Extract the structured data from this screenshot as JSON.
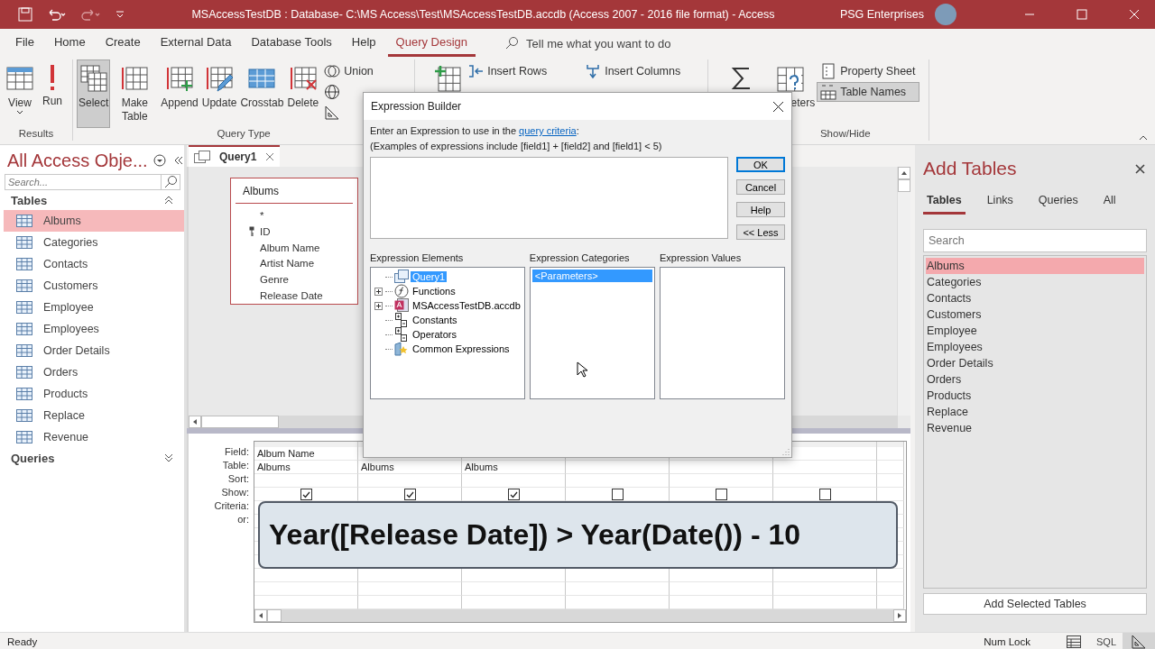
{
  "window": {
    "title": "MSAccessTestDB : Database- C:\\MS Access\\Test\\MSAccessTestDB.accdb (Access 2007 - 2016 file format)  -  Access",
    "user": "PSG Enterprises"
  },
  "menu_tabs": [
    {
      "label": "File",
      "selected": false
    },
    {
      "label": "Home",
      "selected": false
    },
    {
      "label": "Create",
      "selected": false
    },
    {
      "label": "External Data",
      "selected": false
    },
    {
      "label": "Database Tools",
      "selected": false
    },
    {
      "label": "Help",
      "selected": false
    },
    {
      "label": "Query Design",
      "selected": true
    }
  ],
  "tell_me": {
    "placeholder": "Tell me what you want to do"
  },
  "ribbon": {
    "groups": [
      {
        "label": "Results",
        "controls": [
          {
            "kind": "large",
            "label": "View",
            "dropdown": true,
            "selected": false
          },
          {
            "kind": "large",
            "label": "Run",
            "selected": false
          }
        ]
      },
      {
        "label": "Query Type",
        "controls": [
          {
            "kind": "large",
            "label": "Select",
            "selected": true
          },
          {
            "kind": "large",
            "label": "Make Table",
            "selected": false
          },
          {
            "kind": "large",
            "label": "Append",
            "selected": false
          },
          {
            "kind": "large",
            "label": "Update",
            "selected": false
          },
          {
            "kind": "large",
            "label": "Crosstab",
            "selected": false
          },
          {
            "kind": "large",
            "label": "Delete",
            "selected": false
          },
          {
            "kind": "column",
            "items": [
              {
                "label": "Union",
                "selected": false
              },
              {
                "selected": false
              },
              {
                "selected": false
              }
            ]
          }
        ]
      },
      {
        "controls": [
          {
            "kind": "large",
            "selected": false
          },
          {
            "kind": "column",
            "items": [
              {
                "label": "Insert Rows",
                "selected": false
              }
            ]
          },
          {
            "kind": "column",
            "items": [
              {
                "label": "Insert Columns",
                "selected": false
              }
            ]
          }
        ]
      },
      {
        "label": "Show/Hide",
        "controls": [
          {
            "kind": "large",
            "selected": false
          },
          {
            "kind": "large",
            "label": "eters",
            "selected": false
          },
          {
            "kind": "column",
            "items": [
              {
                "label": "Property Sheet",
                "selected": false
              },
              {
                "label": "Table Names",
                "selected": true
              }
            ]
          }
        ]
      }
    ]
  },
  "nav": {
    "title": "All Access Obje...",
    "search": {
      "placeholder": "Search..."
    },
    "sections": [
      {
        "label": "Tables",
        "expanded": true,
        "items": [
          {
            "label": "Albums",
            "selected": true
          },
          {
            "label": "Categories",
            "selected": false
          },
          {
            "label": "Contacts",
            "selected": false
          },
          {
            "label": "Customers",
            "selected": false
          },
          {
            "label": "Employee",
            "selected": false
          },
          {
            "label": "Employees",
            "selected": false
          },
          {
            "label": "Order Details",
            "selected": false
          },
          {
            "label": "Orders",
            "selected": false
          },
          {
            "label": "Products",
            "selected": false
          },
          {
            "label": "Replace",
            "selected": false
          },
          {
            "label": "Revenue",
            "selected": false
          }
        ]
      },
      {
        "label": "Queries",
        "expanded": false
      }
    ]
  },
  "document_tab": {
    "label": "Query1"
  },
  "field_list": {
    "title": "Albums",
    "fields": [
      {
        "label": "*",
        "key": false
      },
      {
        "label": "ID",
        "key": true
      },
      {
        "label": "Album Name",
        "key": false
      },
      {
        "label": "Artist Name",
        "key": false
      },
      {
        "label": "Genre",
        "key": false
      },
      {
        "label": "Release Date",
        "key": false
      }
    ]
  },
  "design_grid": {
    "row_labels": [
      "Field:",
      "Table:",
      "Sort:",
      "Show:",
      "Criteria:",
      "or:"
    ],
    "columns": [
      {
        "field": "Album Name",
        "table": "Albums",
        "show": true
      },
      {
        "table": "Albums",
        "show": true
      },
      {
        "table": "Albums",
        "show": true
      },
      {
        "show": false
      },
      {
        "show": false
      },
      {
        "show": false
      }
    ]
  },
  "caption": {
    "text": "Year([Release Date]) > Year(Date()) - 10"
  },
  "dialog": {
    "title": "Expression Builder",
    "instruction": {
      "text": "Enter an Expression to use in the ",
      "link": "query criteria",
      "end": ":"
    },
    "examples": "(Examples of expressions include [field1] + [field2] and [field1] < 5)",
    "buttons": [
      {
        "label": "OK",
        "default": true
      },
      {
        "label": "Cancel",
        "default": false
      },
      {
        "label": "Help",
        "default": false
      },
      {
        "label": "<< Less",
        "default": false
      }
    ],
    "elements": {
      "label": "Expression Elements",
      "items": [
        {
          "label": "Query1",
          "selected": true
        },
        {
          "label": "Functions",
          "selected": false,
          "expanded": false
        },
        {
          "label": "MSAccessTestDB.accdb",
          "selected": false,
          "expanded": false
        },
        {
          "label": "Constants",
          "selected": false
        },
        {
          "label": "Operators",
          "selected": false
        },
        {
          "label": "Common Expressions",
          "selected": false
        }
      ]
    },
    "categories": {
      "label": "Expression Categories",
      "items": [
        {
          "label": "<Parameters>",
          "selected": true
        }
      ]
    },
    "values": {
      "label": "Expression Values"
    }
  },
  "add_tables": {
    "title": "Add Tables",
    "tabs": [
      {
        "label": "Tables",
        "selected": true
      },
      {
        "label": "Links",
        "selected": false
      },
      {
        "label": "Queries",
        "selected": false
      },
      {
        "label": "All",
        "selected": false
      }
    ],
    "search": {
      "placeholder": "Search"
    },
    "items": [
      {
        "label": "Albums",
        "selected": true
      },
      {
        "label": "Categories",
        "selected": false
      },
      {
        "label": "Contacts",
        "selected": false
      },
      {
        "label": "Customers",
        "selected": false
      },
      {
        "label": "Employee",
        "selected": false
      },
      {
        "label": "Employees",
        "selected": false
      },
      {
        "label": "Order Details",
        "selected": false
      },
      {
        "label": "Orders",
        "selected": false
      },
      {
        "label": "Products",
        "selected": false
      },
      {
        "label": "Replace",
        "selected": false
      },
      {
        "label": "Revenue",
        "selected": false
      }
    ],
    "button": "Add Selected Tables"
  },
  "status_bar": {
    "text": "Ready",
    "indicator": "Num Lock",
    "views": [
      {
        "kind": "datasheet",
        "selected": false
      },
      {
        "kind": "sql",
        "label": "SQL",
        "selected": false
      },
      {
        "kind": "design",
        "selected": true
      }
    ]
  }
}
